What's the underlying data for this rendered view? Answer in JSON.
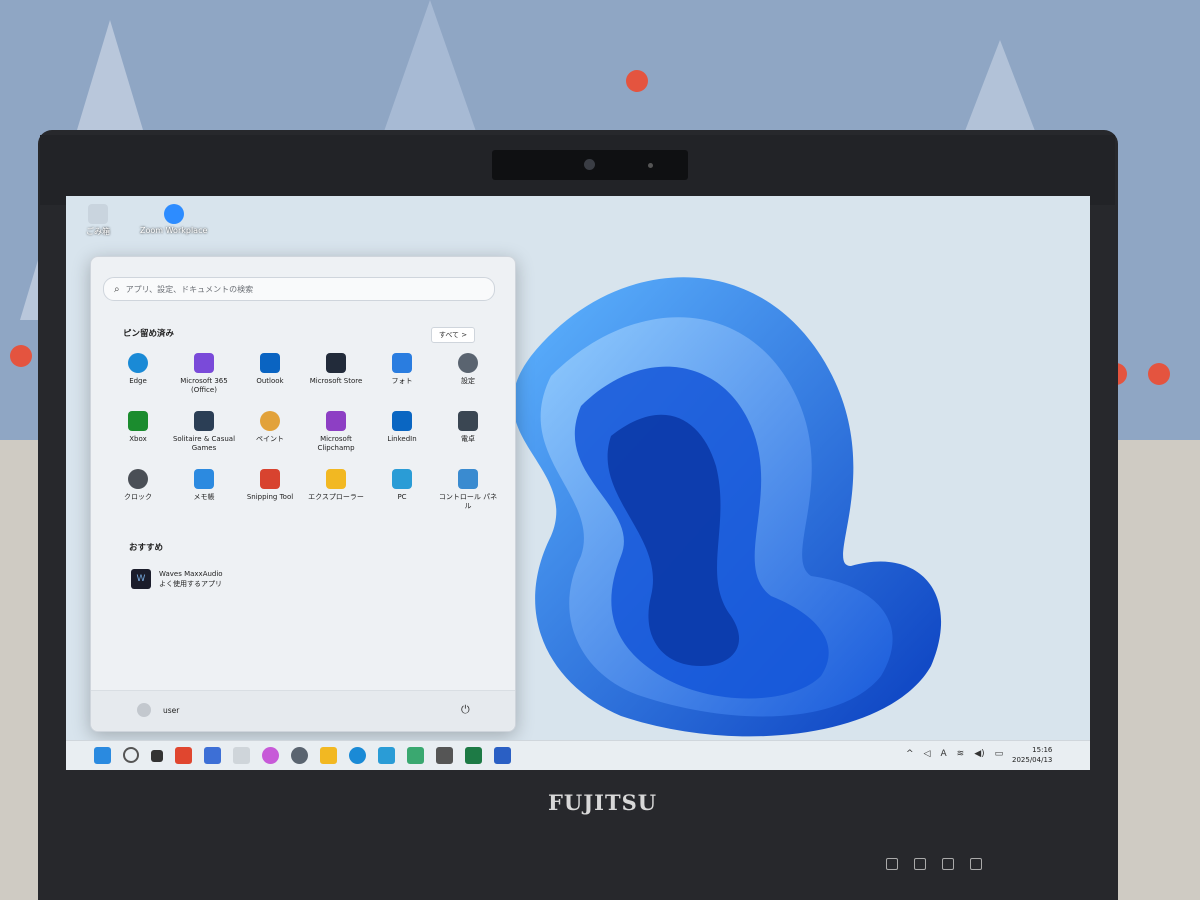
{
  "desktop": {
    "icons": [
      {
        "label": "ごみ箱",
        "icon": "recycle-bin-icon"
      },
      {
        "label": "Zoom Workplace",
        "icon": "zoom-icon"
      }
    ]
  },
  "start_menu": {
    "search_placeholder": "アプリ、設定、ドキュメントの検索",
    "pinned_title": "ピン留め済み",
    "all_button": "すべて >",
    "pinned_apps": [
      {
        "label": "Edge",
        "icon": "edge-icon",
        "color": "#1a8ad6"
      },
      {
        "label": "Microsoft 365 (Office)",
        "icon": "office-icon",
        "color": "#7a4ad9"
      },
      {
        "label": "Outlook",
        "icon": "outlook-icon",
        "color": "#0a64c2"
      },
      {
        "label": "Microsoft Store",
        "icon": "store-icon",
        "color": "#222b3a"
      },
      {
        "label": "フォト",
        "icon": "photos-icon",
        "color": "#2a7de0"
      },
      {
        "label": "設定",
        "icon": "gear-icon",
        "color": "#5a6470"
      },
      {
        "label": "Xbox",
        "icon": "xbox-icon",
        "color": "#1b8c2e"
      },
      {
        "label": "Solitaire & Casual Games",
        "icon": "solitaire-icon",
        "color": "#2b3e55"
      },
      {
        "label": "ペイント",
        "icon": "paint-icon",
        "color": "#e2a23a"
      },
      {
        "label": "Microsoft Clipchamp",
        "icon": "clipchamp-icon",
        "color": "#8d3fc4"
      },
      {
        "label": "LinkedIn",
        "icon": "linkedin-icon",
        "color": "#0a66c2"
      },
      {
        "label": "電卓",
        "icon": "calculator-icon",
        "color": "#3a4652"
      },
      {
        "label": "クロック",
        "icon": "clock-icon",
        "color": "#4a4f56"
      },
      {
        "label": "メモ帳",
        "icon": "notepad-icon",
        "color": "#2c8ae0"
      },
      {
        "label": "Snipping Tool",
        "icon": "snipping-icon",
        "color": "#d8432f"
      },
      {
        "label": "エクスプローラー",
        "icon": "folder-icon",
        "color": "#f2b822"
      },
      {
        "label": "PC",
        "icon": "monitor-icon",
        "color": "#2a9cd6"
      },
      {
        "label": "コントロール パネル",
        "icon": "control-panel-icon",
        "color": "#3a8bd0"
      }
    ],
    "recommended_title": "おすすめ",
    "recommended": [
      {
        "title": "Waves MaxxAudio",
        "subtitle": "よく使用するアプリ",
        "icon": "waves-icon"
      }
    ],
    "user_name": "user",
    "power_icon": "power-icon"
  },
  "taskbar": {
    "icons": [
      {
        "name": "start-icon",
        "color": "#2a8ae0"
      },
      {
        "name": "search-icon",
        "color": "#555"
      },
      {
        "name": "task-view-icon",
        "color": "#333"
      },
      {
        "name": "app-red-icon",
        "color": "#e0462f"
      },
      {
        "name": "store-icon",
        "color": "#3d6fd6"
      },
      {
        "name": "app-de-icon",
        "color": "#444"
      },
      {
        "name": "copilot-icon",
        "color": "#c75ad8"
      },
      {
        "name": "gear-icon",
        "color": "#5a6470"
      },
      {
        "name": "folder-icon",
        "color": "#f2b822"
      },
      {
        "name": "edge-icon",
        "color": "#1a8ad6"
      },
      {
        "name": "monitor-icon",
        "color": "#2a9cd6"
      },
      {
        "name": "app-grid-icon",
        "color": "#3aa870"
      },
      {
        "name": "camera-icon",
        "color": "#444"
      },
      {
        "name": "excel-icon",
        "color": "#1d7a45"
      },
      {
        "name": "word-icon",
        "color": "#2a5fc4"
      }
    ],
    "tray_symbols": [
      "^",
      "◁",
      "A",
      "≋",
      "◀)",
      "▭"
    ],
    "time": "15:16",
    "date": "2025/04/13"
  },
  "hardware": {
    "brand": "FUJITSU"
  }
}
